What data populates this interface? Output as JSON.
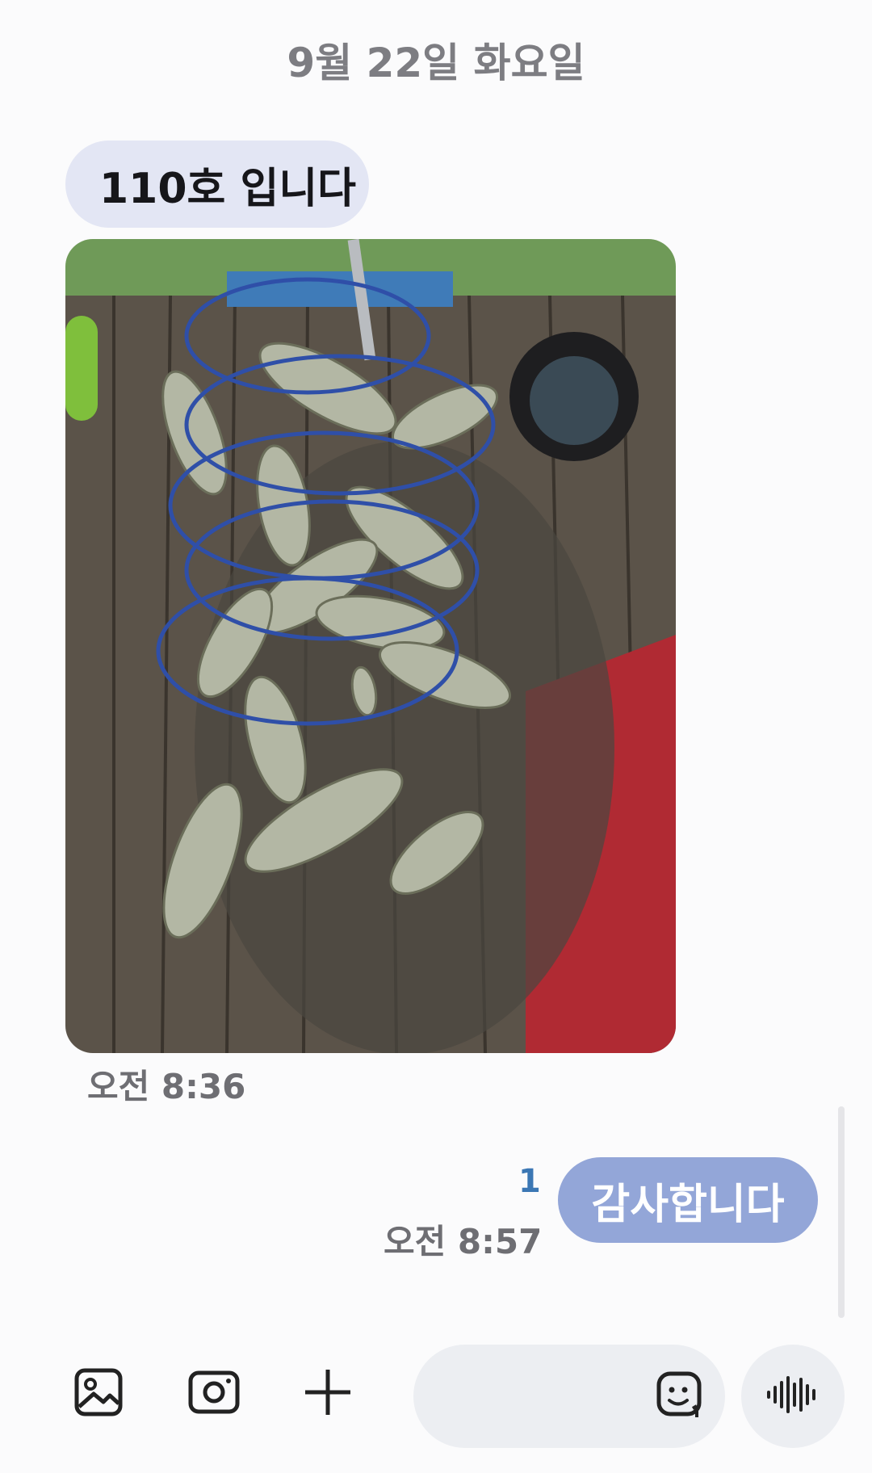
{
  "date_header": "9월 22일 화요일",
  "messages": {
    "incoming_text": "110호 입니다",
    "incoming_photo_icon": "photo-fish-catch-on-dock",
    "incoming_time": "오전 8:36",
    "outgoing_text": "감사합니다",
    "outgoing_unread_count": "1",
    "outgoing_time": "오전 8:57"
  },
  "composer": {
    "icons": [
      "gallery-icon",
      "camera-icon",
      "plus-icon",
      "emoji-icon",
      "voice-icon"
    ],
    "input_value": ""
  },
  "colors": {
    "incoming_bubble": "#e3e6f4",
    "outgoing_bubble": "#93a6d8",
    "unread": "#3b77b4",
    "background": "#fbfbfc"
  }
}
